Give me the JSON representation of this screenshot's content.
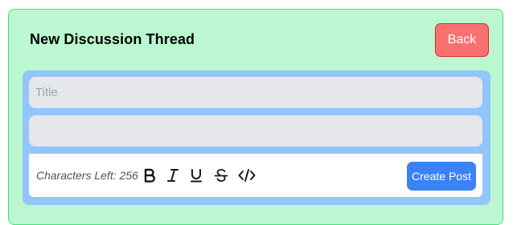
{
  "header": {
    "title": "New Discussion Thread",
    "back_label": "Back"
  },
  "form": {
    "title_placeholder": "Title",
    "title_value": "",
    "body_value": ""
  },
  "toolbar": {
    "chars_left_label": "Characters Left: 256",
    "format_icons": [
      "bold-icon",
      "italic-icon",
      "underline-icon",
      "strikethrough-icon",
      "code-icon"
    ],
    "create_label": "Create Post"
  },
  "colors": {
    "panel_bg": "#bbf7d0",
    "panel_border": "#4ade80",
    "back_bg": "#f87171",
    "form_bg": "#93c5fd",
    "input_bg": "#e5e7eb",
    "create_bg": "#3b82f6"
  }
}
